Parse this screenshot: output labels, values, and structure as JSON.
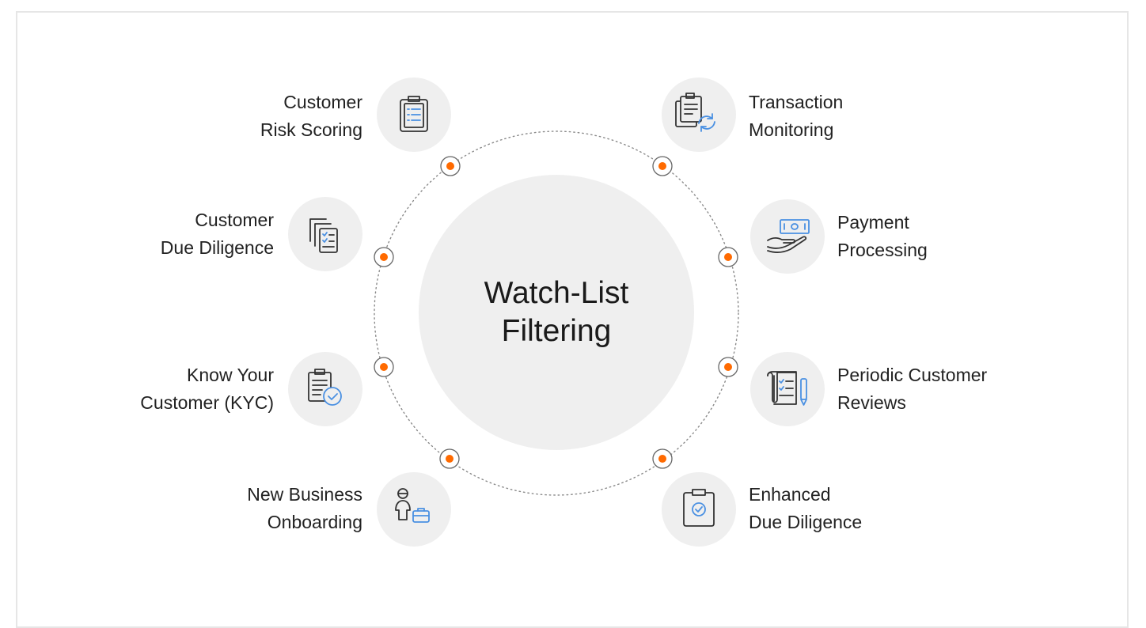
{
  "center": {
    "line1": "Watch-List",
    "line2": "Filtering"
  },
  "colors": {
    "bubble": "#efefef",
    "dot": "#ff6a00",
    "icon_dark": "#333333",
    "icon_accent": "#4a90e2",
    "ring": "#8a8a8a"
  },
  "items": [
    {
      "line1": "Customer",
      "line2": "Risk Scoring",
      "icon": "clipboard-list-icon"
    },
    {
      "line1": "Customer",
      "line2": "Due Diligence",
      "icon": "stacked-checklist-icon"
    },
    {
      "line1": "Know Your",
      "line2": "Customer (KYC)",
      "icon": "document-check-icon"
    },
    {
      "line1": "New Business",
      "line2": "Onboarding",
      "icon": "person-briefcase-icon"
    },
    {
      "line1": "Transaction",
      "line2": "Monitoring",
      "icon": "document-refresh-icon"
    },
    {
      "line1": "Payment",
      "line2": "Processing",
      "icon": "hand-money-icon"
    },
    {
      "line1": "Periodic Customer",
      "line2": "Reviews",
      "icon": "scroll-pen-icon"
    },
    {
      "line1": "Enhanced",
      "line2": "Due Diligence",
      "icon": "clipboard-check-icon"
    }
  ]
}
